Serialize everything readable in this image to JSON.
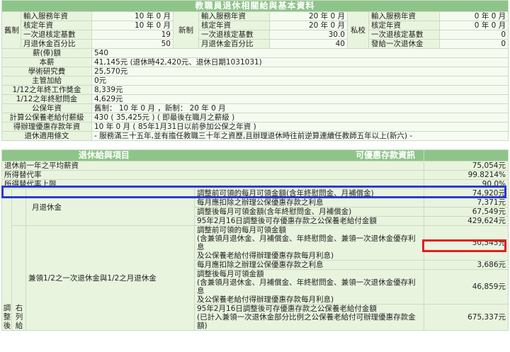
{
  "top": {
    "title": "教職員退休相關給與基本資料",
    "old_group": "舊制",
    "new_group": "新制",
    "private_group": "私校",
    "rows": [
      {
        "old_label": "輸入服務年資",
        "old_value": "10 年 0 月",
        "new_label": "輸入服務年資",
        "new_value": "20 年 0 月",
        "priv_label": "輸入服務年資",
        "priv_value": "0 年 0 月"
      },
      {
        "old_label": "核定年資",
        "old_value": "10 年 0 月",
        "new_label": "核定年資",
        "new_value": "20 年 0 月",
        "priv_label": "核定年資",
        "priv_value": "0 年 0 月"
      },
      {
        "old_label": "一次退核定基數",
        "old_value": "19",
        "new_label": "一次退核定基數",
        "new_value": "30.0",
        "priv_label": "一次退核定基數",
        "priv_value": "0"
      },
      {
        "old_label": "月退休金百分比",
        "old_value": "50",
        "new_label": "月退休金百分比",
        "new_value": "40",
        "priv_label": "發給一次退休金",
        "priv_value": "0"
      }
    ],
    "info": [
      {
        "label": "薪(俸)額",
        "value": "540"
      },
      {
        "label": "本薪",
        "value": "41,145元 (退休時42,420元、退休日期1031031)"
      },
      {
        "label": "學術研究費",
        "value": "25,570元"
      },
      {
        "label": "主管加給",
        "value": "0元"
      },
      {
        "label": "1/12之年終工作獎金",
        "value": "8,339元"
      },
      {
        "label": "1/12之年終慰問金",
        "value": "4,629元"
      },
      {
        "label": "公保年資",
        "value": "舊制： 10 年 0 月 ，新制： 20 年 0 月"
      },
      {
        "label": "計算公保養老給付薪級",
        "value": "430 ( 35,425元 ) ( 即最後在職月之薪級 )"
      },
      {
        "label": "得辦理優惠存款年資",
        "value": "10 年 0 月 ( 85年1月31日以前參加公保之年資 )"
      },
      {
        "label": "退休適用條文",
        "value": "- 服務滿三十五年,並有擔任教職三十年之資歷,且辦理退休時往前逆算連續任教師五年以上(新六) -"
      }
    ]
  },
  "bottom": {
    "left_header": "退休給與項目",
    "right_header": "可優惠存款資訊",
    "avg_label": "退休前一年之平均薪資",
    "avg_value": "75,054元",
    "rate_label": "所得替代率",
    "rate_value": "99.8214%",
    "cap_label": "所得替代率上限",
    "cap_value": "90.0%",
    "side_label_1": "調整後",
    "side_label_2": "右列給",
    "monthly": {
      "label": "月退休金",
      "rows": [
        {
          "label": "調整前可領的每月可領金額(含年終慰問金、月補償金)",
          "value": "74,920元"
        },
        {
          "label": "每月應扣除之辦理公保優惠存款之利息",
          "value": "7,371元"
        },
        {
          "label": "調整後每月可領金額(含年終慰問金、月補償金)",
          "value": "67,549元"
        },
        {
          "label": "95年2月16日調整後可存優惠存款之公保養老給付金額",
          "value": "429,624元"
        }
      ]
    },
    "half": {
      "label": "兼領1/2之一次退休金與1/2之月退休金",
      "rows": [
        {
          "label": "調整前可領的每月可領金額\n(含兼領月退休金、月補償金、年終慰問金、兼領一次退休金優存利息\n及公保養老給付得辦理優惠存款每月利息)",
          "value": "50,545元"
        },
        {
          "label": "每月應扣除之辦理公保優惠存款之利息",
          "value": "3,686元"
        },
        {
          "label": "調整後每月可領金額\n(含兼領月退休金、月補償金、年終慰問金、兼領一次退休金優存利息\n及公保養老給付得辦理優惠存款每月利息)",
          "value": "46,859元"
        },
        {
          "label": "95年2月16日調整後可存優惠存款之公保養老給付金額\n(已計入兼領一次退休金部分比例之公保養老給付可辦理優惠存款金額)",
          "value": "675,337元"
        }
      ]
    }
  },
  "colors": {
    "header": "#8ec48a",
    "label_bg": "#e9f4df",
    "value_bg": "#f6fbf1",
    "highlight_blue": "#2a3bd0",
    "highlight_red": "#e02020"
  }
}
